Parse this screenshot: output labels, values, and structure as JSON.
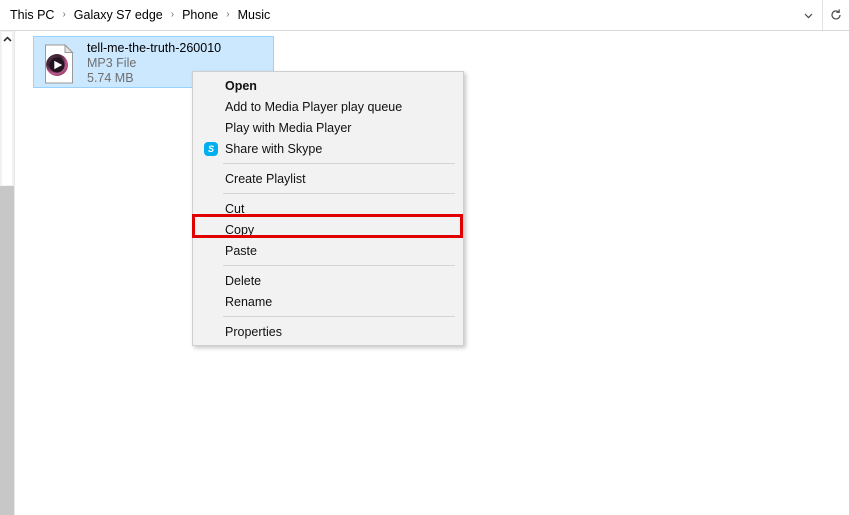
{
  "addressbar": {
    "breadcrumb": [
      {
        "label": "This PC"
      },
      {
        "label": "Galaxy S7 edge"
      },
      {
        "label": "Phone"
      },
      {
        "label": "Music"
      }
    ],
    "separator": "›",
    "dropdown_icon": "chevron-down-icon",
    "refresh_icon": "refresh-icon"
  },
  "scrollbar": {
    "up_arrow_icon": "chevron-up-icon"
  },
  "file": {
    "name": "tell-me-the-truth-260010",
    "type": "MP3 File",
    "size": "5.74 MB",
    "icon": "audio-file-play-icon",
    "selected": true,
    "selection_color": "#cce8ff"
  },
  "context_menu": {
    "items": [
      {
        "label": "Open",
        "bold": true,
        "icon": null
      },
      {
        "label": "Add to Media Player play queue",
        "bold": false,
        "icon": null
      },
      {
        "label": "Play with Media Player",
        "bold": false,
        "icon": null
      },
      {
        "label": "Share with Skype",
        "bold": false,
        "icon": "skype-icon"
      },
      {
        "separator": true
      },
      {
        "label": "Create Playlist",
        "bold": false,
        "icon": null
      },
      {
        "separator": true
      },
      {
        "label": "Cut",
        "bold": false,
        "icon": null
      },
      {
        "label": "Copy",
        "bold": false,
        "icon": null
      },
      {
        "label": "Paste",
        "bold": false,
        "icon": null
      },
      {
        "separator": true
      },
      {
        "label": "Delete",
        "bold": false,
        "icon": null
      },
      {
        "label": "Rename",
        "bold": false,
        "icon": null
      },
      {
        "separator": true
      },
      {
        "label": "Properties",
        "bold": false,
        "icon": null
      }
    ],
    "skype_badge_text": "S"
  },
  "annotation": {
    "target_label": "Copy",
    "color": "#e00000"
  }
}
